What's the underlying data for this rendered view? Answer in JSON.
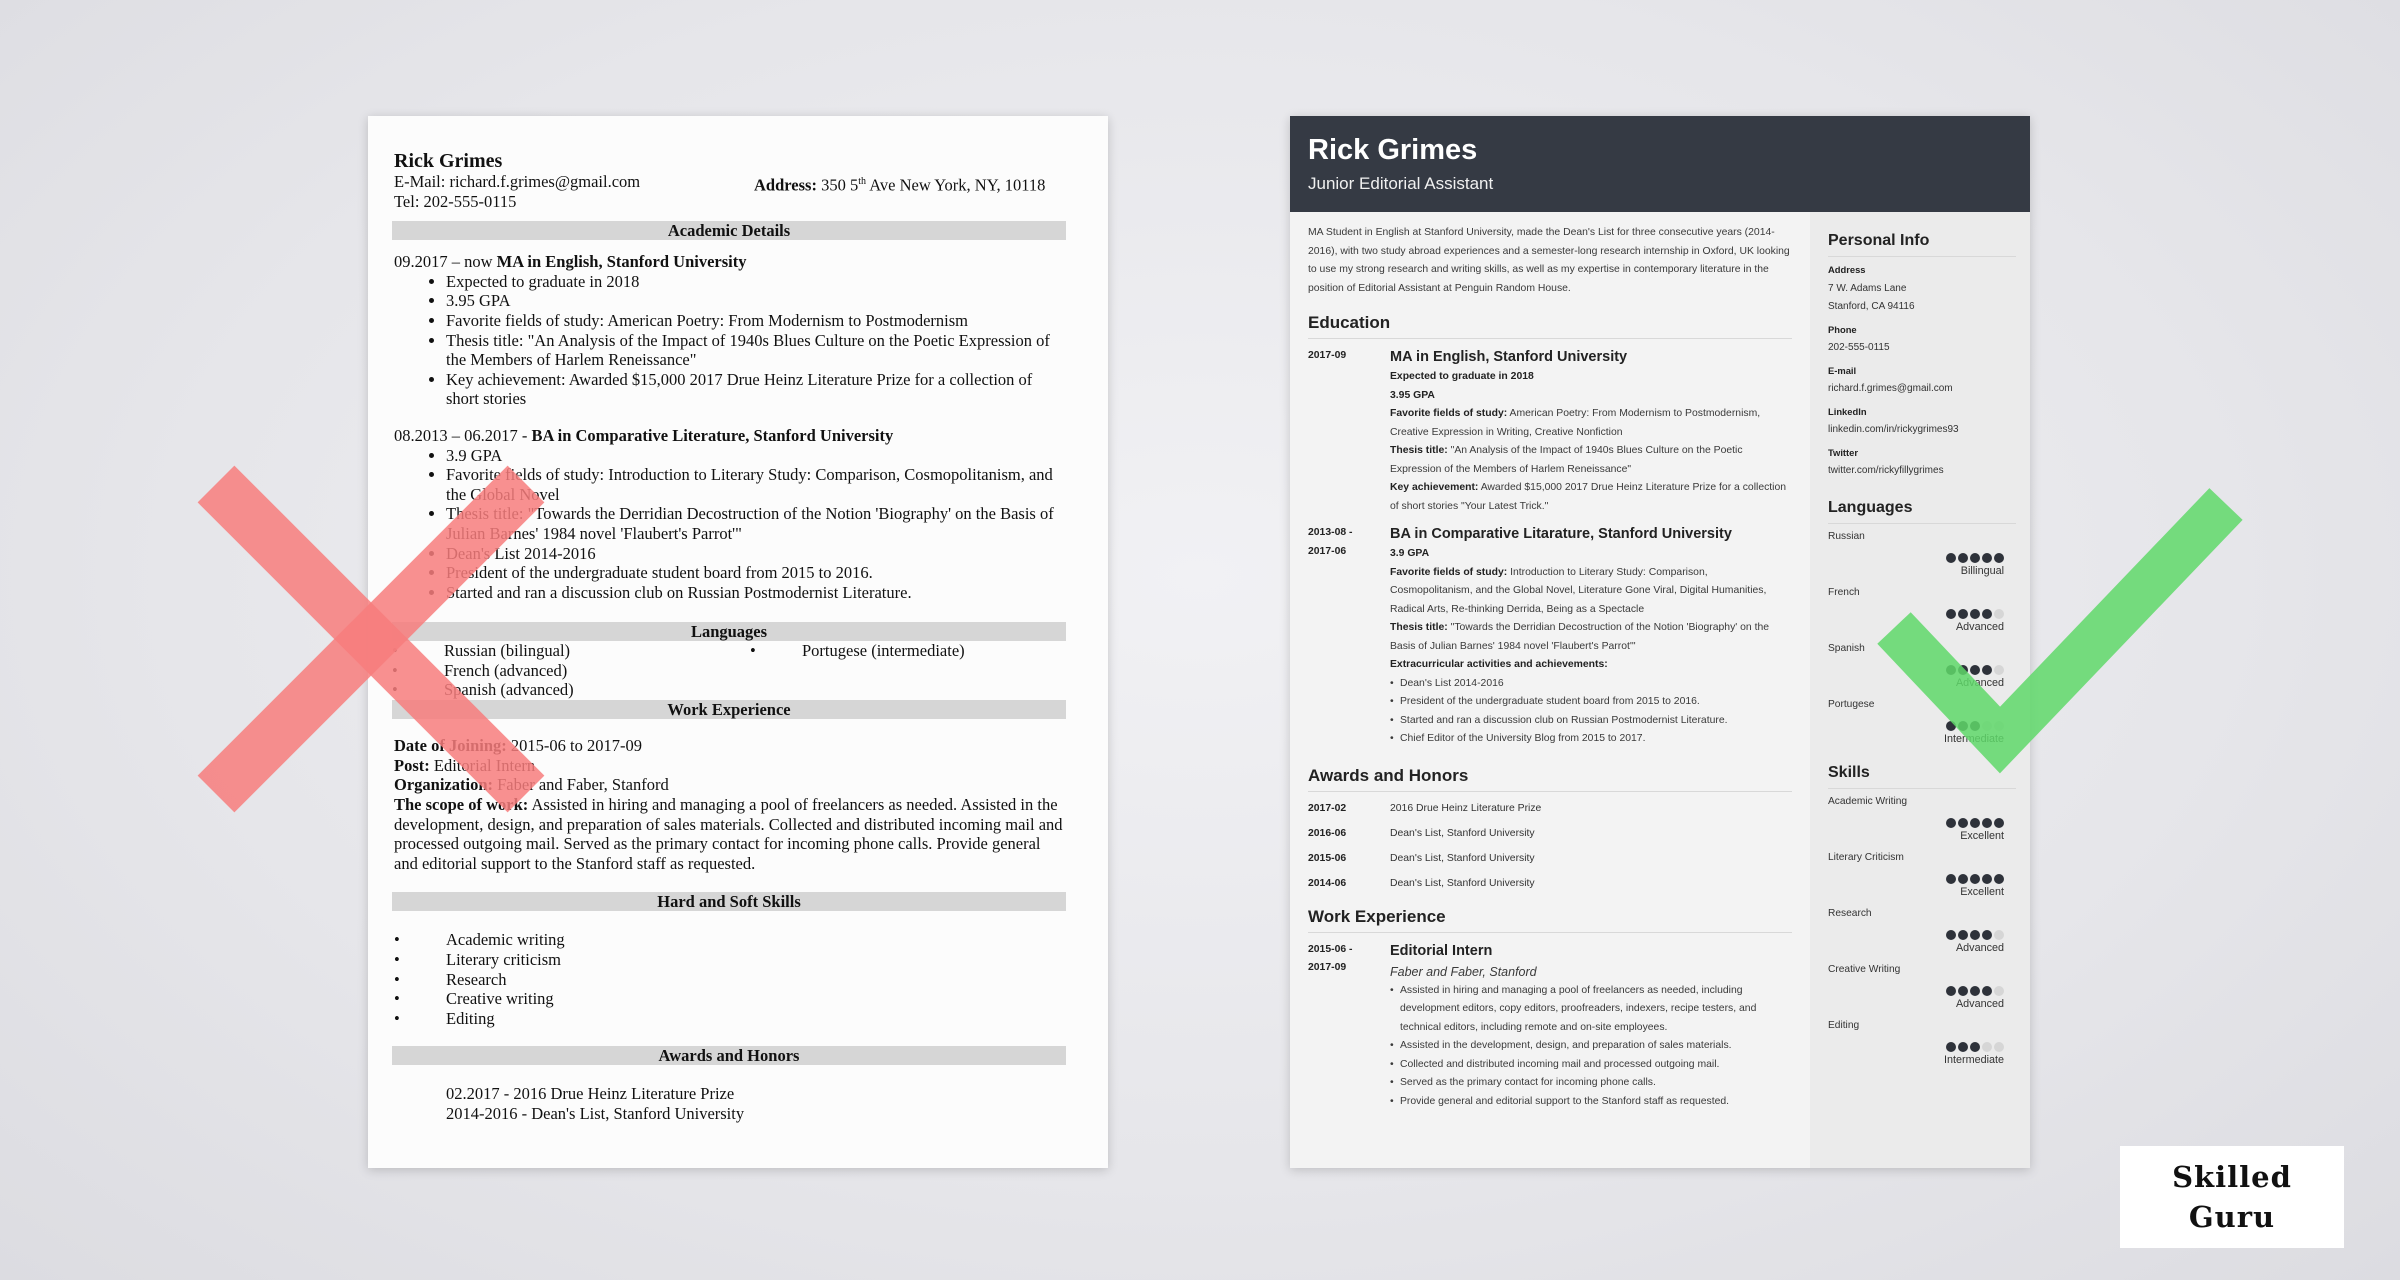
{
  "left_resume": {
    "verdict": "bad",
    "name": "Rick Grimes",
    "email_label": "E-Mail:",
    "email": "richard.f.grimes@gmail.com",
    "address_label": "Address:",
    "address_pre": "350 5",
    "address_sup": "th",
    "address_post": " Ave New York, NY, 10118",
    "tel_label": "Tel:",
    "tel": "202-555-0115",
    "sections": {
      "academic": "Academic Details",
      "languages": "Languages",
      "work": "Work Experience",
      "skills": "Hard and Soft Skills",
      "awards": "Awards and Honors"
    },
    "education": [
      {
        "dates": "09.2017 – now ",
        "degree": "MA in English, Stanford University",
        "bullets": [
          "Expected to graduate in 2018",
          "3.95 GPA",
          "Favorite fields of study: American Poetry: From Modernism to Postmodernism",
          "Thesis title: \"An Analysis of the Impact of 1940s Blues Culture on the Poetic Expression of the Members of Harlem Reneissance\"",
          "Key achievement: Awarded $15,000 2017 Drue Heinz Literature Prize for a collection of short stories"
        ]
      },
      {
        "dates": "08.2013 – 06.2017 - ",
        "degree": "BA in Comparative Literature, Stanford University",
        "bullets": [
          "3.9 GPA",
          "Favorite fields of study: Introduction to Literary Study: Comparison, Cosmopolitanism, and the Global Novel",
          "Thesis title: \"Towards the Derridian Decostruction of the Notion 'Biography' on the Basis of Julian Barnes' 1984 novel 'Flaubert's Parrot'\"",
          "Dean's List 2014-2016",
          "President of the undergraduate student board from 2015 to 2016.",
          "Started and ran a discussion club on Russian Postmodernist Literature."
        ]
      }
    ],
    "languages_col1": [
      "Russian  (bilingual)",
      "French (advanced)",
      "Spanish (advanced)"
    ],
    "languages_col2": [
      "Portugese (intermediate)"
    ],
    "work": {
      "date_label": "Date of Joining:",
      "date": " 2015-06 to 2017-09",
      "post_label": "Post:",
      "post": " Editorial Intern",
      "org_label": "Organization:",
      "org": " Faber and Faber, Stanford",
      "scope_label": "The scope of work:",
      "scope": " Assisted in hiring and managing a pool of freelancers as needed. Assisted in the development, design, and preparation of sales materials. Collected and distributed incoming mail and processed outgoing mail. Served as the primary contact for incoming phone calls. Provide general and editorial support to the Stanford staff as requested."
    },
    "skills": [
      "Academic writing",
      "Literary criticism",
      "Research",
      "Creative writing",
      "Editing"
    ],
    "awards": [
      "02.2017 - 2016 Drue Heinz Literature Prize",
      "2014-2016 - Dean's List, Stanford University"
    ]
  },
  "right_resume": {
    "verdict": "good",
    "name": "Rick Grimes",
    "title": "Junior Editorial Assistant",
    "summary": "MA Student in English at Stanford University, made the Dean's List for three consecutive years (2014-2016), with two study abroad experiences and a semester-long research internship in Oxford, UK looking to use my strong research and writing skills, as well as my expertise in contemporary literature in the position of Editorial Assistant at Penguin Random House.",
    "headings": {
      "education": "Education",
      "awards": "Awards and Honors",
      "work": "Work Experience",
      "personal": "Personal Info",
      "languages": "Languages",
      "skills": "Skills"
    },
    "education": [
      {
        "date": "2017-09",
        "degree": "MA in English, Stanford University",
        "lines": [
          {
            "bold": "Expected to graduate in 2018",
            "text": ""
          },
          {
            "bold": "3.95 GPA",
            "text": ""
          },
          {
            "bold": "Favorite fields of study:",
            "text": " American Poetry: From Modernism to Postmodernism, Creative Expression in Writing, Creative Nonfiction"
          },
          {
            "bold": "Thesis title:",
            "text": " \"An Analysis of the Impact of 1940s Blues Culture on the Poetic Expression of the Members of Harlem Reneissance\""
          },
          {
            "bold": "Key achievement:",
            "text": " Awarded $15,000 2017 Drue Heinz Literature Prize for a collection of short stories \"Your Latest Trick.\""
          }
        ]
      },
      {
        "date": "2013-08 - 2017-06",
        "degree": "BA in Comparative Litarature, Stanford University",
        "lines": [
          {
            "bold": "3.9 GPA",
            "text": ""
          },
          {
            "bold": "Favorite fields of study:",
            "text": " Introduction to Literary Study: Comparison, Cosmopolitanism, and the Global Novel, Literature Gone Viral, Digital Humanities, Radical Arts, Re-thinking Derrida, Being as a Spectacle"
          },
          {
            "bold": "Thesis title:",
            "text": " \"Towards the Derridian Decostruction of the Notion 'Biography' on the Basis of Julian Barnes' 1984 novel 'Flaubert's Parrot'\""
          },
          {
            "bold": "Extracurricular activities and achievements:",
            "text": ""
          }
        ],
        "bullets": [
          "Dean's List 2014-2016",
          "President of the undergraduate student board from 2015 to 2016.",
          "Started and ran a discussion club on Russian Postmodernist Literature.",
          "Chief Editor of the University Blog from 2015 to 2017."
        ]
      }
    ],
    "awards": [
      {
        "date": "2017-02",
        "text": "2016 Drue Heinz Literature Prize"
      },
      {
        "date": "2016-06",
        "text": "Dean's List, Stanford University"
      },
      {
        "date": "2015-06",
        "text": "Dean's List, Stanford University"
      },
      {
        "date": "2014-06",
        "text": "Dean's List, Stanford University"
      }
    ],
    "work": {
      "date": "2015-06 - 2017-09",
      "role": "Editorial Intern",
      "company": "Faber and Faber, Stanford",
      "bullets": [
        "Assisted in hiring and managing a pool of freelancers as needed, including development editors, copy editors, proofreaders, indexers, recipe testers, and technical editors, including remote and on-site employees.",
        "Assisted in the development, design, and preparation of sales materials.",
        "Collected and distributed incoming mail and processed outgoing mail.",
        "Served as the primary contact for incoming phone calls.",
        "Provide general and editorial support to the Stanford staff as requested."
      ]
    },
    "personal_info": [
      {
        "label": "Address",
        "values": [
          "7 W. Adams Lane",
          "Stanford, CA 94116"
        ]
      },
      {
        "label": "Phone",
        "values": [
          "202-555-0115"
        ]
      },
      {
        "label": "E-mail",
        "values": [
          "richard.f.grimes@gmail.com"
        ]
      },
      {
        "label": "LinkedIn",
        "values": [
          "linkedin.com/in/rickygrimes93"
        ]
      },
      {
        "label": "Twitter",
        "values": [
          "twitter.com/rickyfillygrimes"
        ]
      }
    ],
    "languages": [
      {
        "name": "Russian",
        "level": "Billingual",
        "rating": 5,
        "max": 5
      },
      {
        "name": "French",
        "level": "Advanced",
        "rating": 4,
        "max": 5
      },
      {
        "name": "Spanish",
        "level": "Advanced",
        "rating": 4,
        "max": 5
      },
      {
        "name": "Portugese",
        "level": "Intermediate",
        "rating": 3,
        "max": 5
      }
    ],
    "skills": [
      {
        "name": "Academic Writing",
        "level": "Excellent",
        "rating": 5,
        "max": 5
      },
      {
        "name": "Literary Criticism",
        "level": "Excellent",
        "rating": 5,
        "max": 5
      },
      {
        "name": "Research",
        "level": "Advanced",
        "rating": 4,
        "max": 5
      },
      {
        "name": "Creative Writing",
        "level": "Advanced",
        "rating": 4,
        "max": 5
      },
      {
        "name": "Editing",
        "level": "Intermediate",
        "rating": 3,
        "max": 5
      }
    ]
  },
  "marks": {
    "bad_icon": "x-mark-icon",
    "bad_color": "#f77c7c",
    "good_icon": "checkmark-icon",
    "good_color": "#5fd86a"
  },
  "logo": {
    "line1": "Skilled",
    "line2": "Guru"
  }
}
